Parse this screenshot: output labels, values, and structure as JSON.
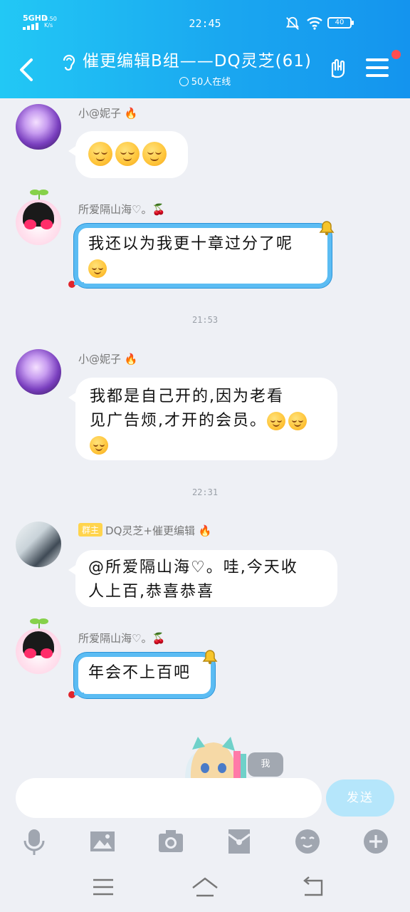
{
  "status_bar": {
    "network": "5GHD",
    "speed": "0.50 K/s",
    "time": "22:45",
    "battery": "40"
  },
  "header": {
    "title": "催更编辑B组——DQ灵芝(61)",
    "online": "50人在线",
    "accent": "#1aa7f0"
  },
  "messages": [
    {
      "sender": "小@妮子",
      "badge": "fire",
      "text": "",
      "emojis": [
        "smile-blush",
        "smile-blush",
        "smile-blush"
      ]
    },
    {
      "sender": "所爱隔山海♡。",
      "badge": "cherry",
      "text": "我还以为我更十章过分了呢",
      "emojis": [
        "laughing-cry"
      ]
    },
    {
      "time": "21:53"
    },
    {
      "sender": "小@妮子",
      "badge": "fire",
      "text_line1": "我都是自己开的,因为老看",
      "text_line2": "见广告烦,才开的会员。",
      "emojis": [
        "smile-blush",
        "smile-blush",
        "smile-blush"
      ]
    },
    {
      "time": "22:31"
    },
    {
      "sender": "DQ灵芝+催更编辑",
      "role": "群主",
      "badge": "fire",
      "text_line1": "@所爱隔山海♡。哇,今天收",
      "text_line2": "人上百,恭喜恭喜"
    },
    {
      "sender": "所爱隔山海♡。",
      "badge": "cherry",
      "text": "年会不上百吧"
    }
  ],
  "me_tag": "我",
  "input": {
    "placeholder": "",
    "send_label": "发送"
  },
  "toolbar": [
    "mic-icon",
    "image-icon",
    "camera-icon",
    "red-packet-icon",
    "emoji-icon",
    "plus-icon"
  ],
  "navbar": [
    "menu-icon",
    "home-icon",
    "back-icon"
  ]
}
